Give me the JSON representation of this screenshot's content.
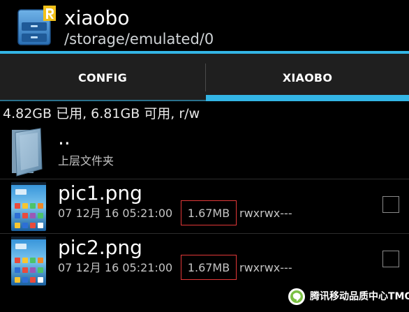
{
  "header": {
    "title": "xiaobo",
    "path": "/storage/emulated/0"
  },
  "tabs": [
    {
      "label": "CONFIG",
      "selected": false
    },
    {
      "label": "XIAOBO",
      "selected": true
    }
  ],
  "storage": {
    "status": "4.82GB 已用, 6.81GB 可用, r/w"
  },
  "files": [
    {
      "name": "..",
      "subtitle": "上层文件夹",
      "icon": "folder-icon"
    },
    {
      "name": "pic1.png",
      "date": "07 12月 16 05:21:00",
      "size": "1.67MB",
      "permissions": "rwxrwx---",
      "checked": false,
      "icon": "image-thumbnail"
    },
    {
      "name": "pic2.png",
      "date": "07 12月 16 05:21:00",
      "size": "1.67MB",
      "permissions": "rwxrwx---",
      "checked": false,
      "icon": "image-thumbnail"
    }
  ],
  "watermark": {
    "text": "腾讯移动品质中心TMQ"
  },
  "colors": {
    "accent": "#33b5e5",
    "highlight_box": "#e23838",
    "background": "#000000"
  }
}
